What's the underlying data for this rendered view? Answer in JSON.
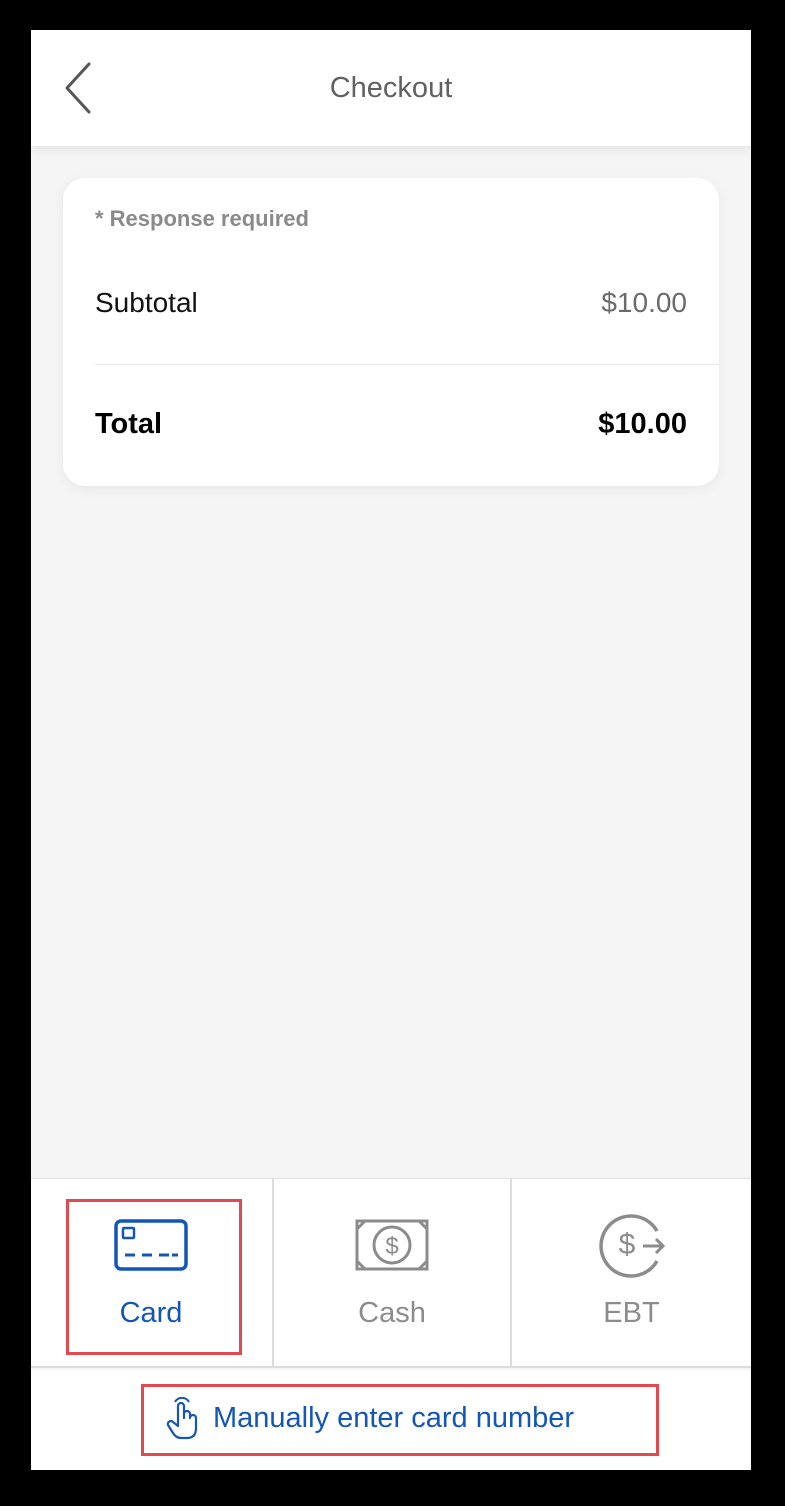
{
  "header": {
    "title": "Checkout",
    "back_icon": "chevron-left-icon"
  },
  "summary": {
    "required_note": "* Response required",
    "subtotal_label": "Subtotal",
    "subtotal_value": "$10.00",
    "total_label": "Total",
    "total_value": "$10.00"
  },
  "payment_methods": [
    {
      "label": "Card",
      "icon": "credit-card-icon",
      "selected": true
    },
    {
      "label": "Cash",
      "icon": "cash-icon",
      "selected": false
    },
    {
      "label": "EBT",
      "icon": "ebt-icon",
      "selected": false
    }
  ],
  "manual_entry": {
    "label": "Manually enter card number",
    "icon": "tap-hand-icon"
  },
  "colors": {
    "accent": "#1456b8",
    "inactive": "#8c8c8c",
    "highlight": "#e24a50",
    "background": "#f5f5f5"
  }
}
